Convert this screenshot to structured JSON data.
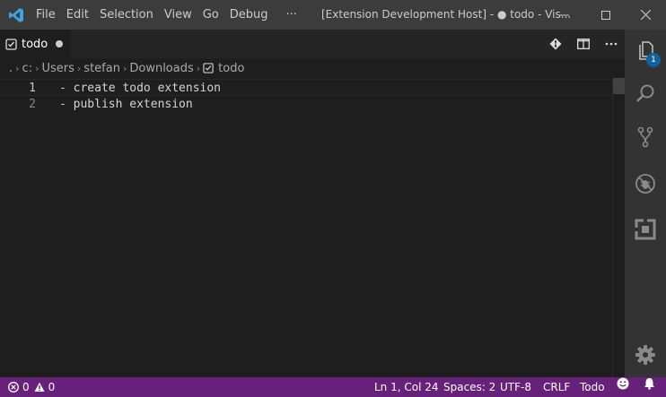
{
  "titlebar": {
    "menu": [
      "File",
      "Edit",
      "Selection",
      "View",
      "Go",
      "Debug",
      "···"
    ],
    "window_title": "[Extension Development Host] - ● todo - Vis..."
  },
  "tab": {
    "label": "todo",
    "dirty": true
  },
  "breadcrumbs": [
    ".",
    "c:",
    "Users",
    "stefan",
    "Downloads",
    "todo"
  ],
  "editor": {
    "lines": [
      {
        "number": "1",
        "text": "- create todo extension"
      },
      {
        "number": "2",
        "text": "- publish extension"
      }
    ]
  },
  "activity_bar": {
    "explorer_badge": "1",
    "icons": [
      "files-icon",
      "search-icon",
      "source-control-icon",
      "debug-icon",
      "extensions-icon",
      "settings-gear-icon"
    ]
  },
  "statusbar": {
    "errors": "0",
    "warnings": "0",
    "position": "Ln 1, Col 24",
    "spaces": "Spaces: 2",
    "encoding": "UTF-8",
    "eol": "CRLF",
    "language": "Todo"
  },
  "colors": {
    "titlebar_bg": "#3c3c3c",
    "statusbar_bg": "#68217a",
    "editor_bg": "#1e1e1e",
    "activitybar_bg": "#333333",
    "badge_bg": "#0e639c",
    "logo_blue": "#3ea2e3"
  }
}
